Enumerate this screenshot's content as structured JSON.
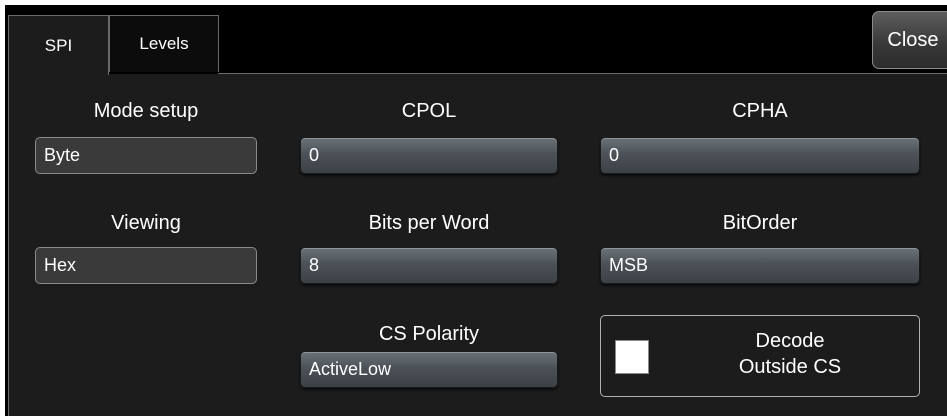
{
  "tabs": [
    {
      "label": "SPI",
      "active": true
    },
    {
      "label": "Levels",
      "active": false
    }
  ],
  "close_label": "Close",
  "fields": {
    "mode_setup": {
      "label": "Mode setup",
      "value": "Byte"
    },
    "cpol": {
      "label": "CPOL",
      "value": "0"
    },
    "cpha": {
      "label": "CPHA",
      "value": "0"
    },
    "viewing": {
      "label": "Viewing",
      "value": "Hex"
    },
    "bits_per_word": {
      "label": "Bits per Word",
      "value": "8"
    },
    "bit_order": {
      "label": "BitOrder",
      "value": "MSB"
    },
    "cs_polarity": {
      "label": "CS Polarity",
      "value": "ActiveLow"
    }
  },
  "decode_outside_cs": {
    "line1": "Decode",
    "line2": "Outside CS",
    "checked": false
  },
  "colors": {
    "background": "#000000",
    "panel": "#1c1c1c",
    "text": "#ffffff",
    "checkbox": "#ffffff"
  }
}
